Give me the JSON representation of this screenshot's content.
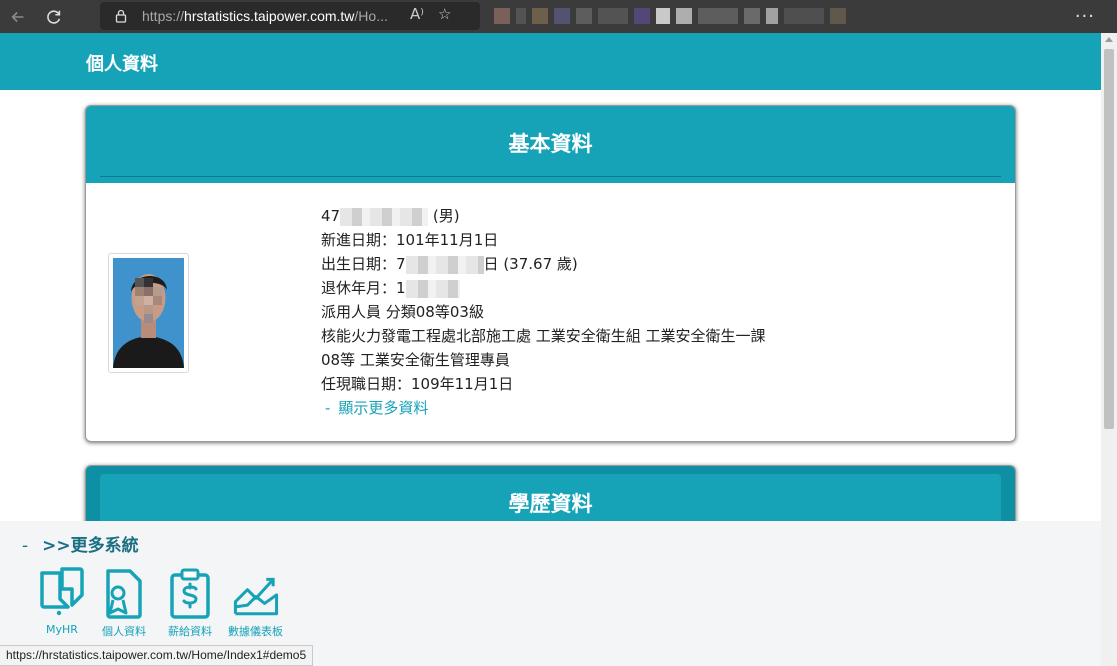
{
  "browser": {
    "url_scheme": "https://",
    "url_host": "hrstatistics.taipower.com.tw",
    "url_path": "/Ho...",
    "menu": "···"
  },
  "header": {
    "title": "個人資料"
  },
  "basic_card": {
    "title": "基本資料",
    "rows": [
      {
        "prefix": "47",
        "suffix": "(男)"
      },
      {
        "prefix": "新進日期：101年11月1日",
        "suffix": ""
      },
      {
        "prefix": "出生日期：7",
        "suffix": "日 (37.67 歲)"
      },
      {
        "prefix": "退休年月：1",
        "suffix": ""
      }
    ],
    "category": "派用人員 分類08等03級",
    "department": "核能火力發電工程處北部施工處 工業安全衛生組 工業安全衛生一課",
    "position": "08等 工業安全衛生管理專員",
    "current_date": "任現職日期：109年11月1日",
    "more_link": "顯示更多資料",
    "more_dash": "-"
  },
  "edu_card": {
    "title": "學歷資料"
  },
  "more_systems": {
    "dash": "-",
    "title": ">>更多系統",
    "items": [
      {
        "label": "MyHR",
        "icon": "myhr-icon"
      },
      {
        "label": "個人資料",
        "icon": "personal-file-icon"
      },
      {
        "label": "薪給資料",
        "icon": "salary-icon"
      },
      {
        "label": "數據儀表板",
        "icon": "dashboard-chart-icon"
      }
    ]
  },
  "status_bar": {
    "text": "https://hrstatistics.taipower.com.tw/Home/Index1#demo5"
  },
  "colors": {
    "accent": "#16a3b8",
    "chrome": "#3b3b3b"
  }
}
